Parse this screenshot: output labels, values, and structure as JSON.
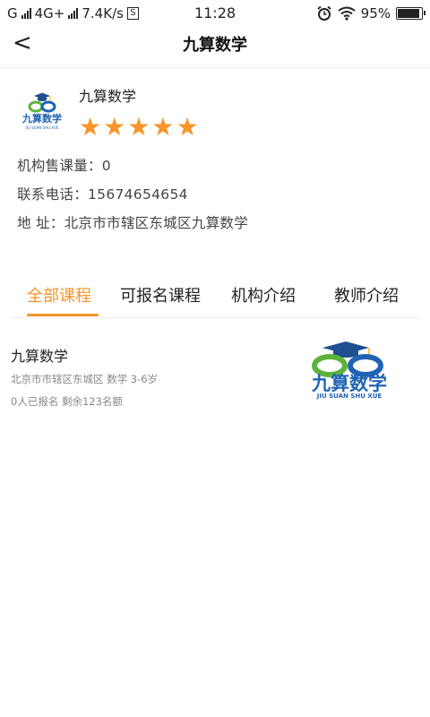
{
  "status_bar": {
    "carrier": "G",
    "network": "4G+",
    "speed": "7.4K/s",
    "speed_box": "S",
    "time": "11:28",
    "battery": "95%",
    "battery_level": 0.95,
    "icons": [
      "signal-icon",
      "alarm-icon",
      "wifi-icon",
      "battery-icon"
    ]
  },
  "nav": {
    "back_icon": "chevron-left-icon",
    "back_glyph": "<",
    "title": "九算数学"
  },
  "org": {
    "name": "九算数学",
    "rating": 5,
    "rating_max": 5,
    "star_color": "#f7942a",
    "sales_line": "机构售课量：0",
    "phone_line": "联系电话：15674654654",
    "address_line": "地 址：北京市市辖区东城区九算数学",
    "logo_text": "九算数学",
    "logo_subtext": "JIU SUAN SHU XUE"
  },
  "tabs": [
    {
      "label": "全部课程",
      "active": true
    },
    {
      "label": "可报名课程",
      "active": false
    },
    {
      "label": "机构介绍",
      "active": false
    },
    {
      "label": "教师介绍",
      "active": false
    }
  ],
  "courses": [
    {
      "title": "九算数学",
      "meta": "北京市市辖区东城区  数学  3-6岁",
      "status": "0人已报名  剩余123名额",
      "logo_text": "九算数学",
      "logo_subtext": "JIU SUAN SHU XUE"
    }
  ],
  "colors": {
    "accent": "#f7942a",
    "logo_green": "#5bb33a",
    "logo_blue": "#1f63b5",
    "logo_cap": "#1f4f8f"
  }
}
